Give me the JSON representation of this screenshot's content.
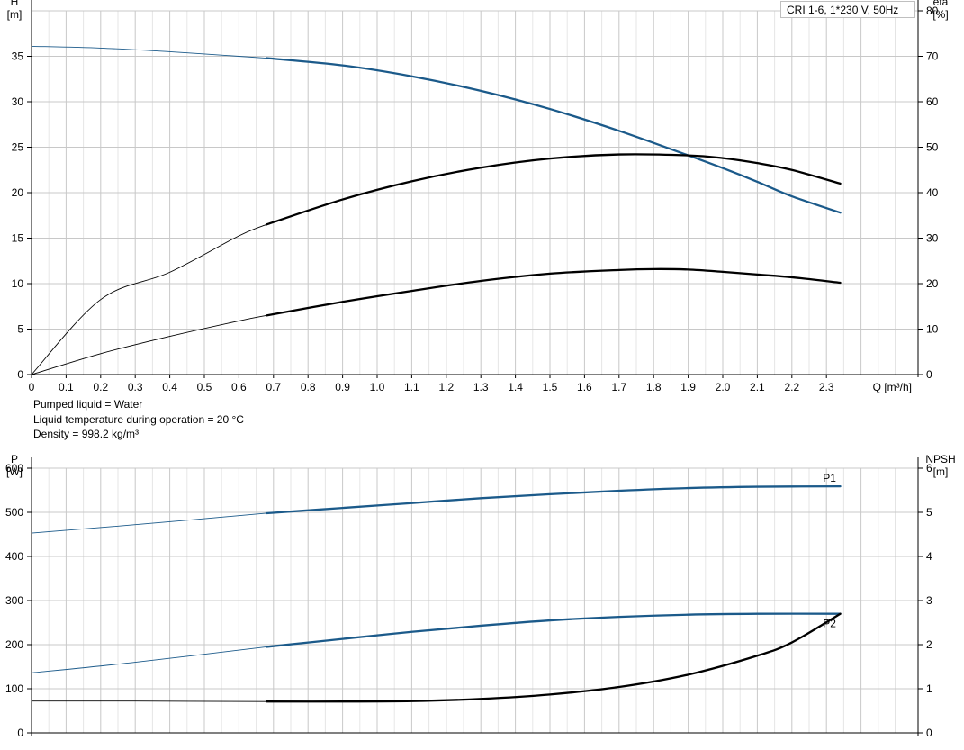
{
  "legend_title": "CRI 1-6, 1*230 V, 50Hz",
  "info_lines": [
    "Pumped liquid = Water",
    "Liquid temperature during operation = 20 °C",
    "Density = 998.2 kg/m³"
  ],
  "colors": {
    "blue": "#1b5a8a",
    "black": "#000000",
    "grid": "#c8c8c8"
  },
  "chart_data": [
    {
      "type": "line",
      "title": "",
      "xlabel": "Q [m³/h]",
      "ylabel_left": [
        "H",
        "[m]"
      ],
      "ylabel_right": [
        "eta",
        "[%]"
      ],
      "xlim": [
        0,
        2.5
      ],
      "ylim_left": [
        0,
        40
      ],
      "ylim_right": [
        0,
        80
      ],
      "x_ticks": [
        "0",
        "0.1",
        "0.2",
        "0.3",
        "0.4",
        "0.5",
        "0.6",
        "0.7",
        "0.8",
        "0.9",
        "1.0",
        "1.1",
        "1.2",
        "1.3",
        "1.4",
        "1.5",
        "1.6",
        "1.7",
        "1.8",
        "1.9",
        "2.0",
        "2.1",
        "2.2",
        "2.3"
      ],
      "y_ticks_left": [
        "0",
        "5",
        "10",
        "15",
        "20",
        "25",
        "30",
        "35"
      ],
      "y_ticks_right": [
        "0",
        "10",
        "20",
        "30",
        "40",
        "50",
        "60",
        "70",
        "80"
      ],
      "grid": true,
      "duty_range": [
        0.68,
        2.34
      ],
      "series": [
        {
          "axis": "left",
          "color": "blue",
          "x": [
            0,
            0.2,
            0.4,
            0.6,
            0.68,
            0.9,
            1.1,
            1.3,
            1.5,
            1.7,
            1.9,
            2.0,
            2.1,
            2.2,
            2.34
          ],
          "y": [
            36.1,
            35.9,
            35.5,
            35.0,
            34.8,
            34.0,
            32.8,
            31.2,
            29.2,
            26.8,
            24.1,
            22.7,
            21.2,
            19.6,
            17.8
          ]
        },
        {
          "axis": "right",
          "color": "black",
          "x": [
            0,
            0.2,
            0.4,
            0.6,
            0.68,
            0.9,
            1.1,
            1.3,
            1.5,
            1.7,
            1.9,
            2.0,
            2.1,
            2.2,
            2.34
          ],
          "y": [
            0,
            16.5,
            22.5,
            30.5,
            33.0,
            38.5,
            42.5,
            45.5,
            47.5,
            48.4,
            48.2,
            47.6,
            46.5,
            45.0,
            42.0
          ]
        },
        {
          "axis": "left",
          "color": "black",
          "x": [
            0,
            0.2,
            0.4,
            0.6,
            0.68,
            0.9,
            1.1,
            1.3,
            1.5,
            1.7,
            1.8,
            1.9,
            2.0,
            2.1,
            2.2,
            2.34
          ],
          "y": [
            0,
            2.3,
            4.2,
            5.9,
            6.5,
            8.0,
            9.2,
            10.3,
            11.1,
            11.5,
            11.6,
            11.55,
            11.3,
            11.0,
            10.7,
            10.1
          ]
        }
      ]
    },
    {
      "type": "line",
      "title": "",
      "xlabel": "",
      "ylabel_left": [
        "P",
        "[W]"
      ],
      "ylabel_right": [
        "NPSH",
        "[m]"
      ],
      "xlim": [
        0,
        2.5
      ],
      "ylim_left": [
        0,
        600
      ],
      "ylim_right": [
        0,
        6
      ],
      "y_ticks_left": [
        "0",
        "100",
        "200",
        "300",
        "400",
        "500",
        "600"
      ],
      "y_ticks_right": [
        "0",
        "1",
        "2",
        "3",
        "4",
        "5",
        "6"
      ],
      "grid": true,
      "duty_range": [
        0.68,
        2.34
      ],
      "series": [
        {
          "name": "P1",
          "axis": "left",
          "color": "blue",
          "x": [
            0,
            0.3,
            0.68,
            0.9,
            1.1,
            1.3,
            1.5,
            1.7,
            1.9,
            2.1,
            2.34
          ],
          "y": [
            453,
            472,
            498,
            510,
            521,
            532,
            541,
            549,
            555,
            558,
            559
          ]
        },
        {
          "name": "P2",
          "axis": "left",
          "color": "blue",
          "x": [
            0,
            0.3,
            0.68,
            0.9,
            1.1,
            1.3,
            1.5,
            1.7,
            1.9,
            2.1,
            2.34
          ],
          "y": [
            136,
            160,
            195,
            213,
            229,
            243,
            255,
            263,
            268,
            270,
            270
          ]
        },
        {
          "axis": "right",
          "color": "black",
          "x": [
            0,
            0.3,
            0.68,
            0.9,
            1.1,
            1.3,
            1.5,
            1.7,
            1.9,
            2.1,
            2.2,
            2.34
          ],
          "y": [
            0.72,
            0.72,
            0.71,
            0.71,
            0.72,
            0.77,
            0.87,
            1.04,
            1.32,
            1.75,
            2.05,
            2.7
          ]
        }
      ]
    }
  ]
}
